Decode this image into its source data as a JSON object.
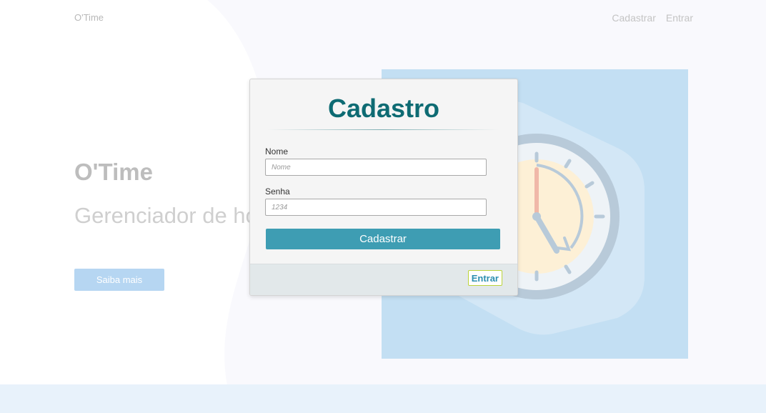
{
  "navbar": {
    "brand": "O'Time",
    "links": [
      "Cadastrar",
      "Entrar"
    ]
  },
  "hero": {
    "title": "O'Time",
    "subtitle": "Gerenciador de horários escolares",
    "button_label": "Saiba mais"
  },
  "modal": {
    "title": "Cadastro",
    "name_label": "Nome",
    "name_placeholder": "Nome",
    "password_label": "Senha",
    "password_placeholder": "1234",
    "submit_label": "Cadastrar",
    "login_label": "Entrar"
  },
  "illustration": {
    "icon": "clock-icon"
  },
  "colors": {
    "accent": "#0e6b73",
    "button": "#3e9db3",
    "illustration_bg": "#c3dff3",
    "clock_hand": "#f0b8a8"
  }
}
